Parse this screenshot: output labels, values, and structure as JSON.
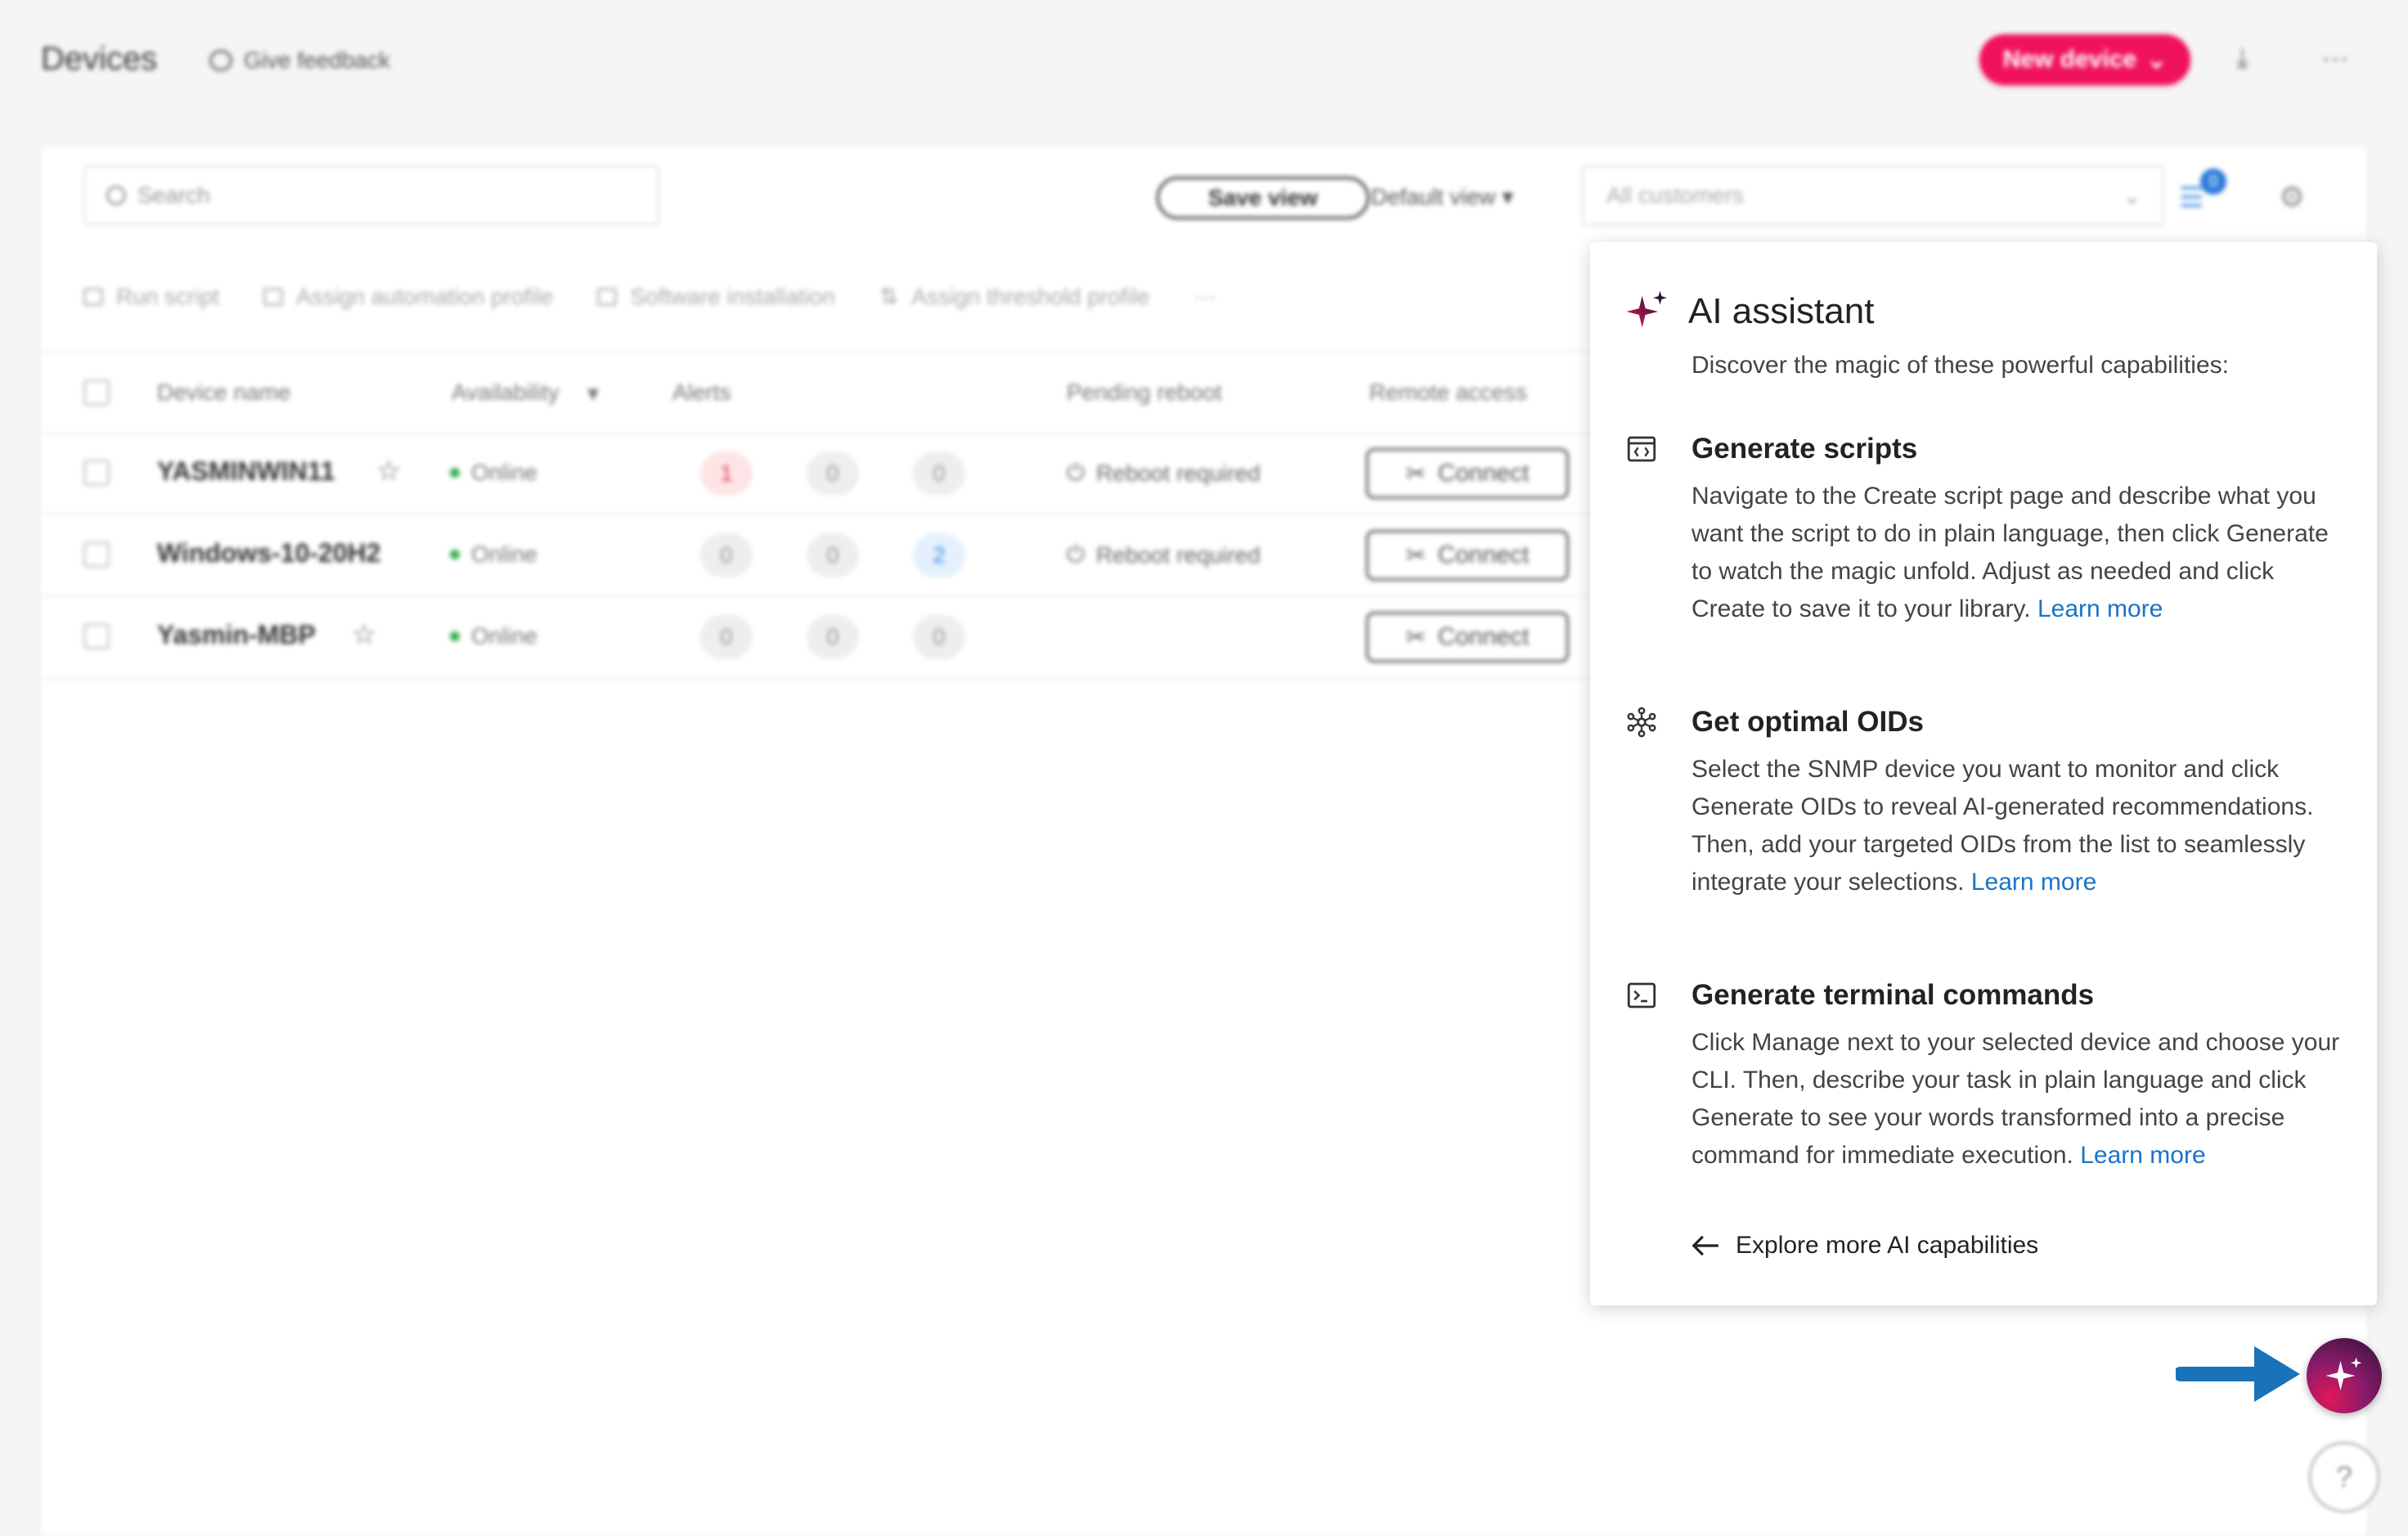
{
  "header": {
    "title": "Devices",
    "feedback_label": "Give feedback",
    "new_device_label": "New device",
    "download_icon": "download-icon",
    "more_icon": "more-icon"
  },
  "toolbar": {
    "search_placeholder": "Search",
    "save_view_label": "Save view",
    "default_view_label": "Default view",
    "customers_placeholder": "All customers",
    "filter_count": "0"
  },
  "actions": [
    {
      "label": "Run script",
      "icon": "script-icon"
    },
    {
      "label": "Assign automation profile",
      "icon": "automation-icon"
    },
    {
      "label": "Software installation",
      "icon": "install-icon"
    },
    {
      "label": "Assign threshold profile",
      "icon": "threshold-icon"
    },
    {
      "label": "···",
      "icon": "more-icon"
    }
  ],
  "table": {
    "columns": [
      "Device name",
      "Availability",
      "Alerts",
      "Pending reboot",
      "Remote access"
    ],
    "rows": [
      {
        "name": "YASMINWIN11",
        "status": "Online",
        "alerts": [
          "1",
          "0",
          "0"
        ],
        "reboot": "Reboot required",
        "connect": "Connect"
      },
      {
        "name": "Windows-10-20H2",
        "status": "Online",
        "alerts": [
          "0",
          "0",
          "2"
        ],
        "reboot": "Reboot required",
        "connect": "Connect"
      },
      {
        "name": "Yasmin-MBP",
        "status": "Online",
        "alerts": [
          "0",
          "0",
          "0"
        ],
        "reboot": "",
        "connect": "Connect"
      }
    ]
  },
  "ai_panel": {
    "title": "AI assistant",
    "subtitle": "Discover the magic of these powerful capabilities:",
    "sections": [
      {
        "icon": "code-window-icon",
        "title": "Generate scripts",
        "body": "Navigate to the Create script page and describe what you want the script to do in plain language, then click Generate to watch the magic unfold. Adjust as needed and click Create to save it to your library.",
        "link": "Learn more"
      },
      {
        "icon": "network-icon",
        "title": "Get optimal OIDs",
        "body": "Select the SNMP device you want to monitor and click Generate OIDs to reveal AI-generated recommendations. Then, add your targeted OIDs from the list to seamlessly integrate your selections.",
        "link": "Learn more"
      },
      {
        "icon": "terminal-icon",
        "title": "Generate terminal commands",
        "body": "Click Manage next to your selected device and choose your CLI. Then, describe your task in plain language and click Generate to see your words transformed into a precise command for immediate execution.",
        "link": "Learn more"
      }
    ],
    "explore_label": "Explore more AI capabilities"
  },
  "colors": {
    "brand": "#f0135b",
    "link": "#1a73c8",
    "arrow": "#1a72b8"
  }
}
